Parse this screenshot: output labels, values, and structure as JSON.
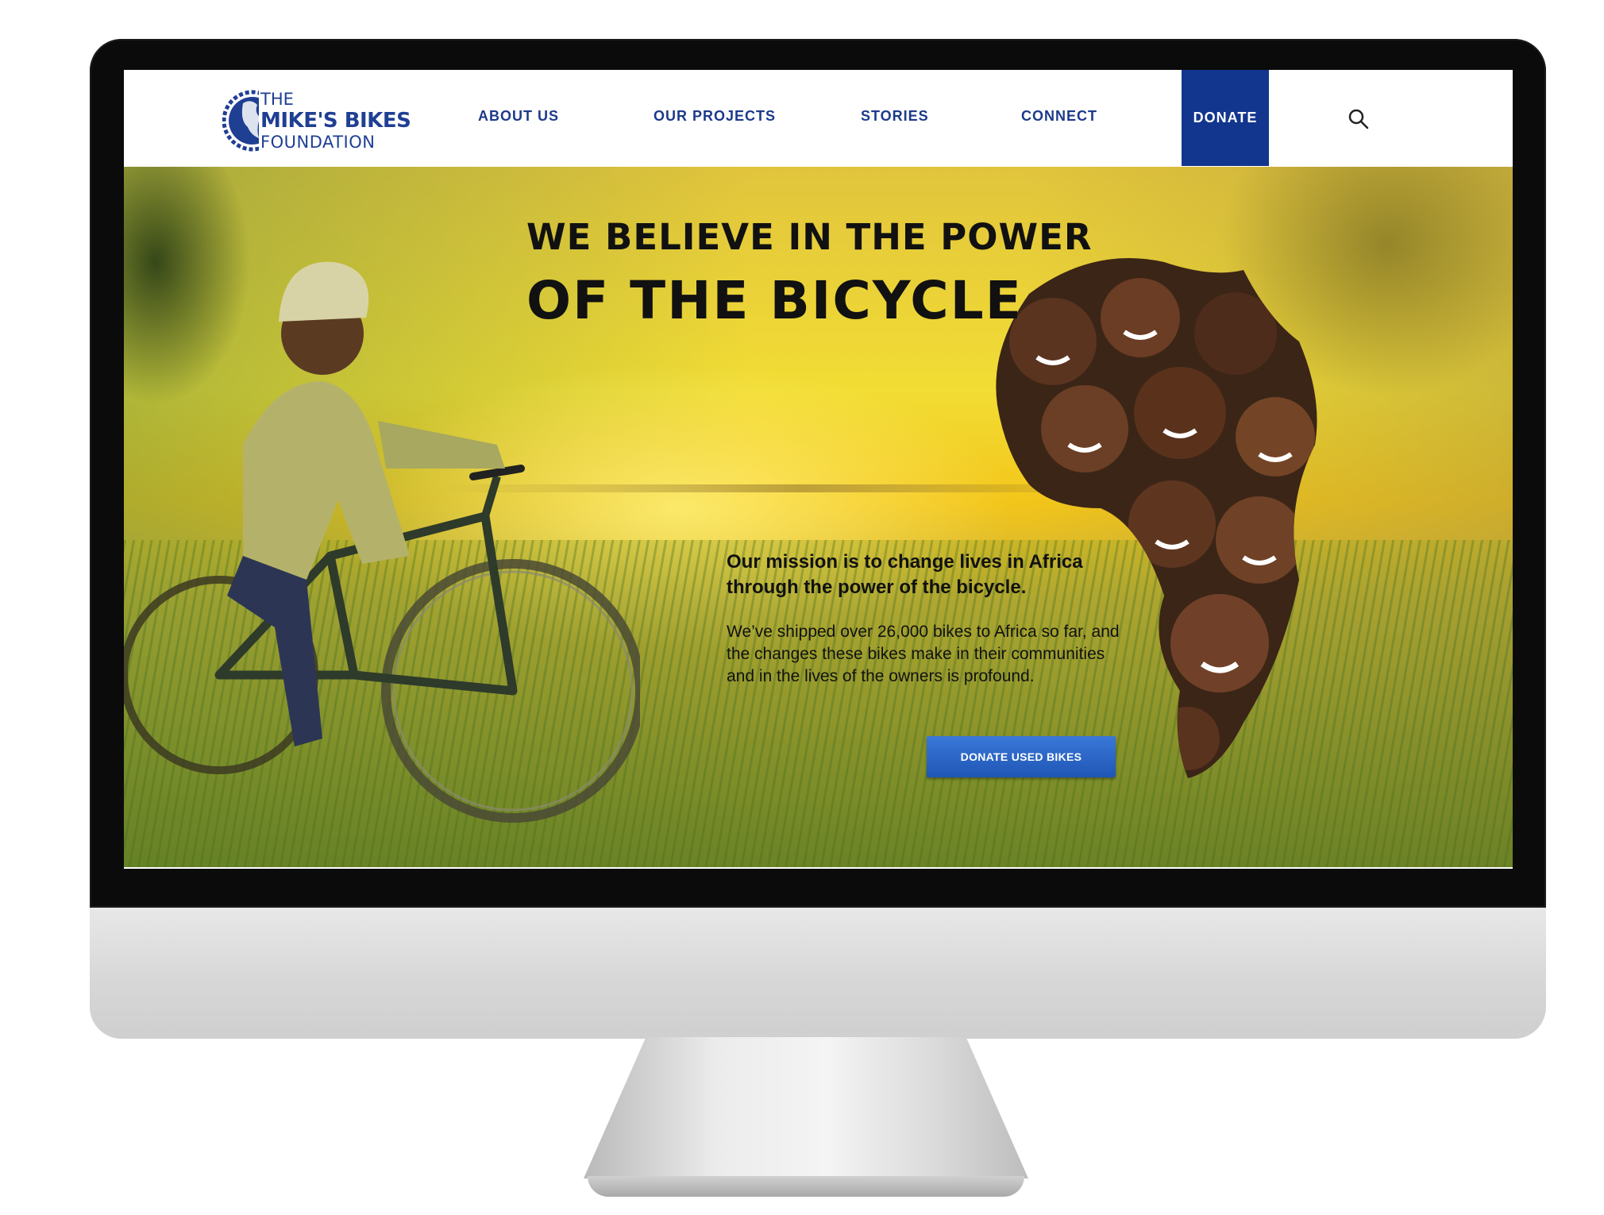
{
  "logo": {
    "line1": "THE",
    "line2": "MIKE'S BIKES",
    "line3": "FOUNDATION"
  },
  "nav": {
    "items": [
      "ABOUT US",
      "OUR PROJECTS",
      "STORIES",
      "CONNECT"
    ],
    "donate_label": "DONATE"
  },
  "hero": {
    "headline_line1": "WE BELIEVE IN THE POWER",
    "headline_line2": "OF THE BICYCLE",
    "mission": "Our mission is to change lives in Africa through the power of the bicycle.",
    "body": "We’ve shipped over 26,000 bikes to Africa so far, and the changes these bikes make in their communities and in the lives of the owners is profound.",
    "cta_label": "DONATE USED BIKES"
  },
  "icons": {
    "logo": "globe-gear-icon",
    "search": "search-icon"
  },
  "colors": {
    "brand_blue": "#12358e",
    "nav_text": "#1d3a8a",
    "hero_yellow": "#f2dd34",
    "cta_blue": "#2a66c8"
  }
}
